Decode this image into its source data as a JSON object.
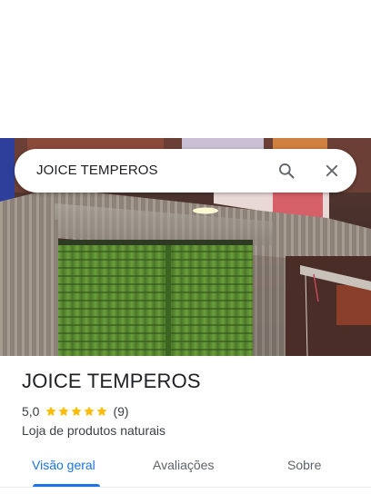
{
  "search": {
    "query": "JOICE TEMPEROS"
  },
  "place": {
    "name": "JOICE TEMPEROS",
    "rating": "5,0",
    "stars": 5,
    "review_count": "(9)",
    "category": "Loja de produtos naturais"
  },
  "tabs": [
    {
      "label": "Visão geral",
      "active": true
    },
    {
      "label": "Avaliações",
      "active": false
    },
    {
      "label": "Sobre",
      "active": false
    }
  ],
  "icons": {
    "search": "search-icon",
    "close": "close-icon",
    "star": "star-icon"
  },
  "colors": {
    "accent": "#1a73e8",
    "star": "#fbbc04",
    "shutter": "#5e8f34"
  }
}
